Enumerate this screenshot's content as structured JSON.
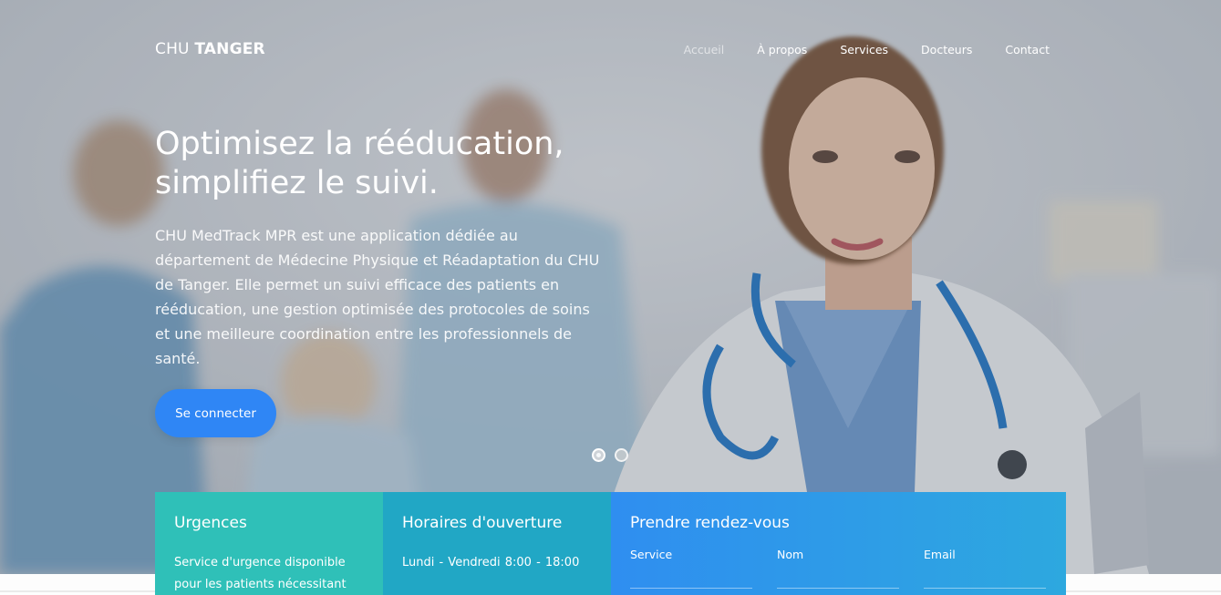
{
  "brand": {
    "light": "CHU",
    "bold": "TANGER"
  },
  "nav": {
    "items": [
      {
        "label": "Accueil",
        "active": true
      },
      {
        "label": "À propos"
      },
      {
        "label": "Services"
      },
      {
        "label": "Docteurs"
      },
      {
        "label": "Contact"
      }
    ]
  },
  "hero": {
    "headline_line1": "Optimisez la rééducation,",
    "headline_line2": "simplifiez le suivi.",
    "lead": "CHU MedTrack MPR est une application dédiée au département de Médecine Physique et Réadaptation du CHU de Tanger. Elle permet un suivi efficace des patients en rééducation, une gestion optimisée des protocoles de soins et une meilleure coordination entre les professionnels de santé.",
    "cta_label": "Se connecter"
  },
  "carousel": {
    "active_index": 0,
    "count": 2
  },
  "boxes": {
    "urgences": {
      "title": "Urgences",
      "text": "Service d'urgence disponible pour les patients nécessitant"
    },
    "horaires": {
      "title": "Horaires d'ouverture",
      "line1": "Lundi - Vendredi  8:00 - 18:00"
    },
    "rdv": {
      "title": "Prendre rendez-vous",
      "fields": [
        {
          "label": "Service"
        },
        {
          "label": "Nom"
        },
        {
          "label": "Email"
        }
      ]
    }
  },
  "colors": {
    "accent_blue": "#2f86f5",
    "teal": "#2fc0b8",
    "cyan": "#21a7c5"
  }
}
